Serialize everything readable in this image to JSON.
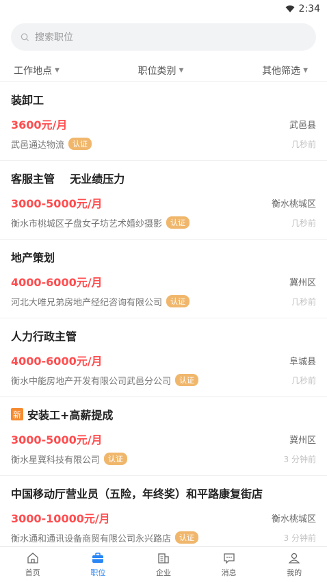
{
  "status": {
    "time": "2:34",
    "icon": "wifi-icon"
  },
  "search": {
    "placeholder": "搜索职位",
    "icon": "search-icon"
  },
  "filters": [
    {
      "label": "工作地点"
    },
    {
      "label": "职位类别"
    },
    {
      "label": "其他筛选"
    }
  ],
  "jobs": [
    {
      "title": "装卸工",
      "salary": "3600元/月",
      "location": "武邑县",
      "company": "武邑通达物流",
      "cert": "认证",
      "time": "几秒前",
      "is_new": false
    },
    {
      "title": "客服主管    无业绩压力",
      "salary": "3000-5000元/月",
      "location": "衡水桃城区",
      "company": "衡水市桃城区子盘女子坊艺术婚纱摄影",
      "cert": "认证",
      "time": "几秒前",
      "is_new": false
    },
    {
      "title": "地产策划",
      "salary": "4000-6000元/月",
      "location": "冀州区",
      "company": "河北大唯兄弟房地产经纪咨询有限公司",
      "cert": "认证",
      "time": "几秒前",
      "is_new": false
    },
    {
      "title": "人力行政主管",
      "salary": "4000-6000元/月",
      "location": "阜城县",
      "company": "衡水中能房地产开发有限公司武邑分公司",
      "cert": "认证",
      "time": "几秒前",
      "is_new": false
    },
    {
      "title": "安装工+高薪提成",
      "salary": "3000-5000元/月",
      "location": "冀州区",
      "company": "衡水星冀科技有限公司",
      "cert": "认证",
      "time": "3 分钟前",
      "is_new": true,
      "new_label": "新"
    },
    {
      "title": "中国移动厅营业员（五险，年终奖）和平路康复街店",
      "salary": "3000-10000元/月",
      "location": "衡水桃城区",
      "company": "衡水通和通讯设备商贸有限公司永兴路店",
      "cert": "认证",
      "time": "3 分钟前",
      "is_new": false
    }
  ],
  "tabs": [
    {
      "label": "首页",
      "icon": "home-icon",
      "active": false
    },
    {
      "label": "职位",
      "icon": "briefcase-icon",
      "active": true
    },
    {
      "label": "企业",
      "icon": "building-icon",
      "active": false
    },
    {
      "label": "消息",
      "icon": "message-icon",
      "active": false
    },
    {
      "label": "我的",
      "icon": "user-icon",
      "active": false
    }
  ],
  "colors": {
    "accent": "#2a86f5",
    "salary": "#ff4d4f",
    "cert_badge": "#f0b76c",
    "new_badge": "#f58a2f"
  }
}
